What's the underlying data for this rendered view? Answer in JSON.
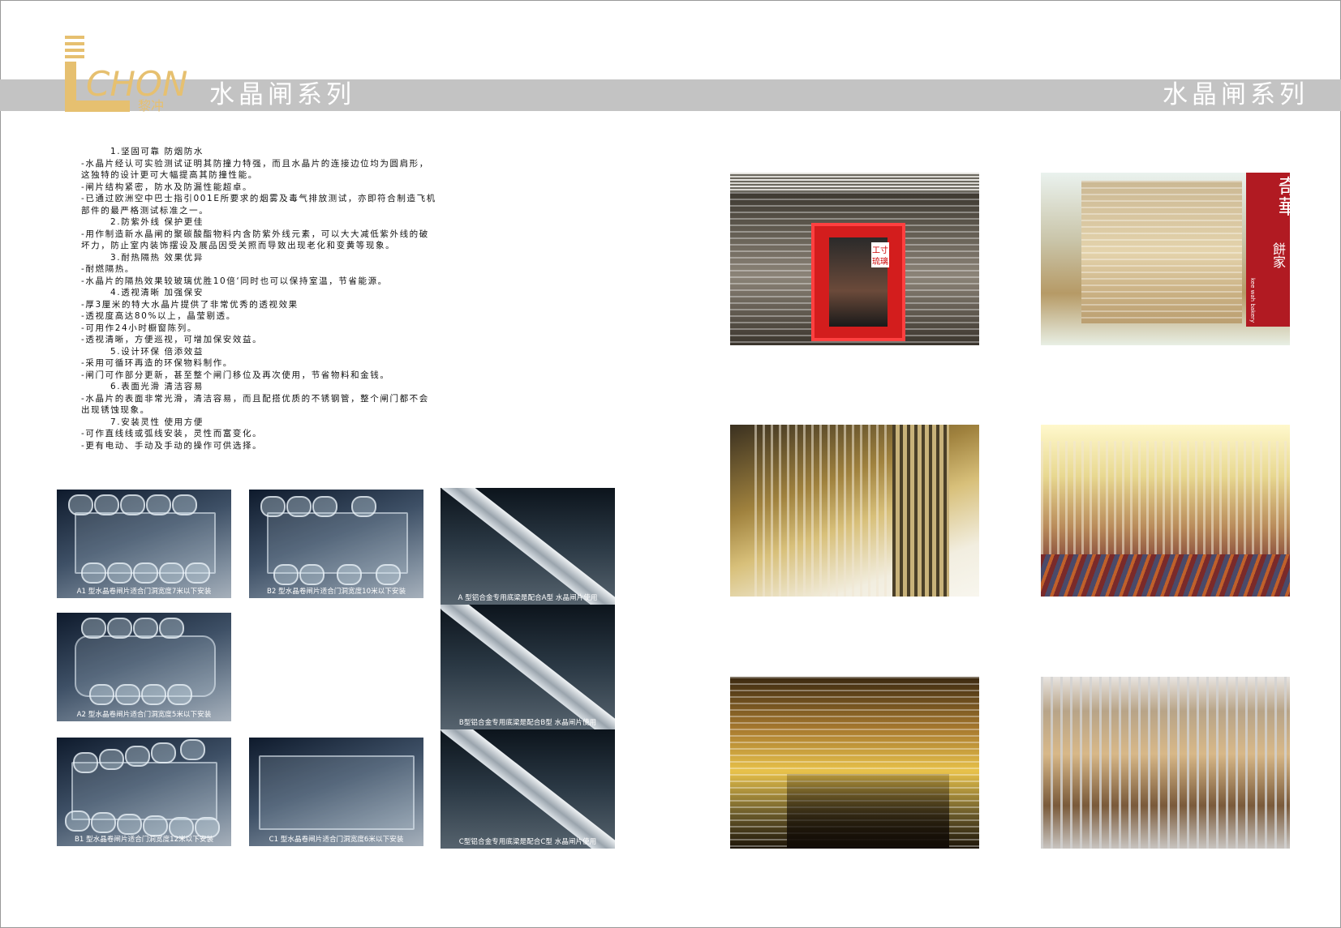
{
  "header": {
    "title_left": "水晶闸系列",
    "title_right": "水晶闸系列"
  },
  "logo": {
    "text": "LICHONG",
    "chinese": "黎冲"
  },
  "features": [
    {
      "type": "heading",
      "text": "1.坚固可靠   防烟防水"
    },
    {
      "type": "text",
      "text": "-水晶片经认可实验测试证明其防撞力特强，而且水晶片的连接边位均为圆肩形，"
    },
    {
      "type": "text",
      "text": "这独特的设计更可大幅提高其防撞性能。"
    },
    {
      "type": "text",
      "text": "-闸片结构紧密，防水及防漏性能超卓。"
    },
    {
      "type": "text",
      "text": "-已通过欧洲空中巴士指引001E所要求的烟雾及毒气排放测试，亦即符合制造飞机"
    },
    {
      "type": "text",
      "text": "部件的最严格测试标准之一。"
    },
    {
      "type": "heading",
      "text": "2.防紫外线    保护更佳"
    },
    {
      "type": "text",
      "text": "-用作制造新水晶闸的聚碳酸酯物料内含防紫外线元素，可以大大减低紫外线的破"
    },
    {
      "type": "text",
      "text": "坏力，防止室内装饰摆设及展品因受关照而导致出现老化和变黄等现象。"
    },
    {
      "type": "heading",
      "text": "3.耐热隔热    效果优异"
    },
    {
      "type": "text",
      "text": "-耐燃隔热。"
    },
    {
      "type": "text",
      "text": "-水晶片的隔热效果较玻璃优胜10倍‘同时也可以保持室温，节省能源。"
    },
    {
      "type": "heading",
      "text": "4.透视清晰   加强保安"
    },
    {
      "type": "text",
      "text": "-厚3厘米的特大水晶片提供了非常优秀的透视效果"
    },
    {
      "type": "text",
      "text": "-透视度高达80%以上，晶莹剔透。"
    },
    {
      "type": "text",
      "text": "-可用作24小时橱窗陈列。"
    },
    {
      "type": "text",
      "text": "-透视清晰，方便巡视，可增加保安效益。"
    },
    {
      "type": "heading",
      "text": "5.设计环保   倍添效益"
    },
    {
      "type": "text",
      "text": "-采用可循环再造的环保物料制作。"
    },
    {
      "type": "text",
      "text": "-闸门可作部分更新，甚至整个闸门移位及再次使用，节省物料和金钱。"
    },
    {
      "type": "heading",
      "text": "6.表面光滑  清洁容易"
    },
    {
      "type": "text",
      "text": "-水晶片的表面非常光滑，清洁容易，而且配搭优质的不锈钢管，整个闸门都不会"
    },
    {
      "type": "text",
      "text": "出现锈蚀现象。"
    },
    {
      "type": "heading",
      "text": "7.安装灵性   使用方便"
    },
    {
      "type": "text",
      "text": "-可作直线线或弧线安装，灵性而富变化。"
    },
    {
      "type": "text",
      "text": "-更有电动、手动及手动的操作可供选择。"
    }
  ],
  "swatches": {
    "a1": "A1 型水晶卷闸片适合门洞宽度7米以下安装",
    "b2": "B2 型水晶卷闸片适合门洞宽度10米以下安装",
    "a2": "A2 型水晶卷闸片适合门洞宽度5米以下安装",
    "b1": "B1 型水晶卷闸片适合门洞宽度12米以下安装",
    "c1": "C1 型水晶卷闸片适合门洞宽度6米以下安装"
  },
  "rails": {
    "a": "A 型铝合金专用底梁是配合A型 水晶闸片使用",
    "b": "B型铝合金专用底梁是配合B型 水晶闸片使用",
    "c": "C型铝合金专用底梁是配合C型 水晶闸片使用"
  },
  "photos": {
    "shop_sign_upper": "工寸",
    "shop_sign_lower": "琉璃",
    "bakery_big": "奇華",
    "bakery_small": "餅家",
    "bakery_en": "kee wah bakery"
  }
}
